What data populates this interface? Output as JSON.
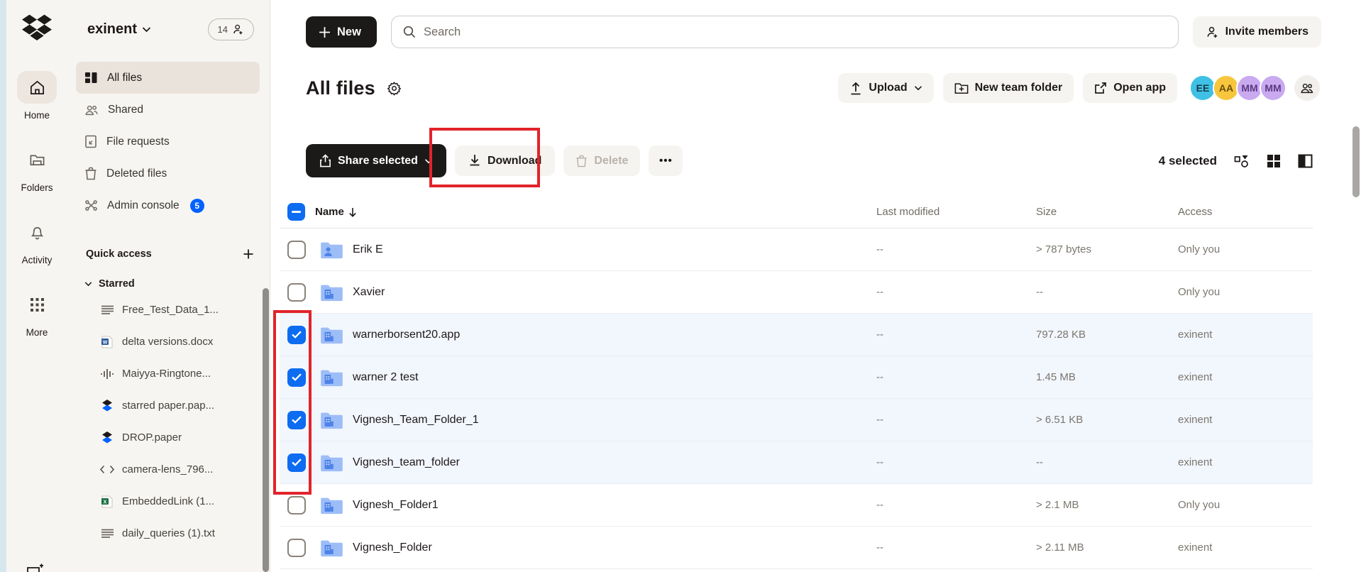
{
  "colors": {
    "accent_blue": "#0061fe",
    "checkbox_blue": "#0d6cf0",
    "annotation_red": "#e2232a",
    "sidebar_bg": "#f7f5f2",
    "selected_row_bg": "#f2f6fd"
  },
  "rail": {
    "items": [
      {
        "label": "Home"
      },
      {
        "label": "Folders"
      },
      {
        "label": "Activity"
      },
      {
        "label": "More"
      }
    ]
  },
  "sidebar": {
    "workspace": "exinent",
    "member_count": "14",
    "nav": [
      {
        "label": "All files"
      },
      {
        "label": "Shared"
      },
      {
        "label": "File requests"
      },
      {
        "label": "Deleted files"
      },
      {
        "label": "Admin console",
        "badge": "5"
      }
    ],
    "quick_access_label": "Quick access",
    "starred_label": "Starred",
    "starred_items": [
      {
        "label": "Free_Test_Data_1..."
      },
      {
        "label": "delta versions.docx"
      },
      {
        "label": "Maiyya-Ringtone..."
      },
      {
        "label": "starred paper.pap..."
      },
      {
        "label": "DROP.paper"
      },
      {
        "label": "camera-lens_796..."
      },
      {
        "label": "EmbeddedLink (1..."
      },
      {
        "label": "daily_queries (1).txt"
      }
    ]
  },
  "topbar": {
    "new_label": "New",
    "search_placeholder": "Search",
    "invite_label": "Invite members"
  },
  "page": {
    "title": "All files"
  },
  "title_actions": {
    "upload_label": "Upload",
    "new_team_folder_label": "New team folder",
    "open_app_label": "Open app",
    "avatars": [
      {
        "initials": "EE",
        "bg": "#3ec1e5",
        "fg": "#1b3a4a"
      },
      {
        "initials": "AA",
        "bg": "#f7c63d",
        "fg": "#6b4d10"
      },
      {
        "initials": "MM",
        "bg": "#c9a9ef",
        "fg": "#5b3a80"
      },
      {
        "initials": "MM",
        "bg": "#c9a9ef",
        "fg": "#5b3a80"
      }
    ]
  },
  "toolbar": {
    "share_label": "Share selected",
    "download_label": "Download",
    "delete_label": "Delete",
    "more_label": "•••",
    "selected_count": "4 selected"
  },
  "table": {
    "columns": {
      "name": "Name",
      "modified": "Last modified",
      "size": "Size",
      "access": "Access"
    },
    "rows": [
      {
        "name": "Erik E",
        "icon": "person-folder",
        "checked": false,
        "selected": false,
        "modified": "--",
        "size": "> 787 bytes",
        "access": "Only you"
      },
      {
        "name": "Xavier",
        "icon": "team-folder",
        "checked": false,
        "selected": false,
        "modified": "--",
        "size": "--",
        "access": "Only you"
      },
      {
        "name": "warnerborsent20.app",
        "icon": "team-folder",
        "checked": true,
        "selected": true,
        "modified": "--",
        "size": "797.28 KB",
        "access": "exinent"
      },
      {
        "name": "warner 2 test",
        "icon": "team-folder",
        "checked": true,
        "selected": true,
        "modified": "--",
        "size": "1.45 MB",
        "access": "exinent"
      },
      {
        "name": "Vignesh_Team_Folder_1",
        "icon": "team-folder",
        "checked": true,
        "selected": true,
        "modified": "--",
        "size": "> 6.51 KB",
        "access": "exinent"
      },
      {
        "name": "Vignesh_team_folder",
        "icon": "team-folder",
        "checked": true,
        "selected": true,
        "modified": "--",
        "size": "--",
        "access": "exinent"
      },
      {
        "name": "Vignesh_Folder1",
        "icon": "team-folder",
        "checked": false,
        "selected": false,
        "modified": "--",
        "size": "> 2.1 MB",
        "access": "Only you"
      },
      {
        "name": "Vignesh_Folder",
        "icon": "team-folder",
        "checked": false,
        "selected": false,
        "modified": "--",
        "size": "> 2.11 MB",
        "access": "exinent"
      }
    ]
  }
}
